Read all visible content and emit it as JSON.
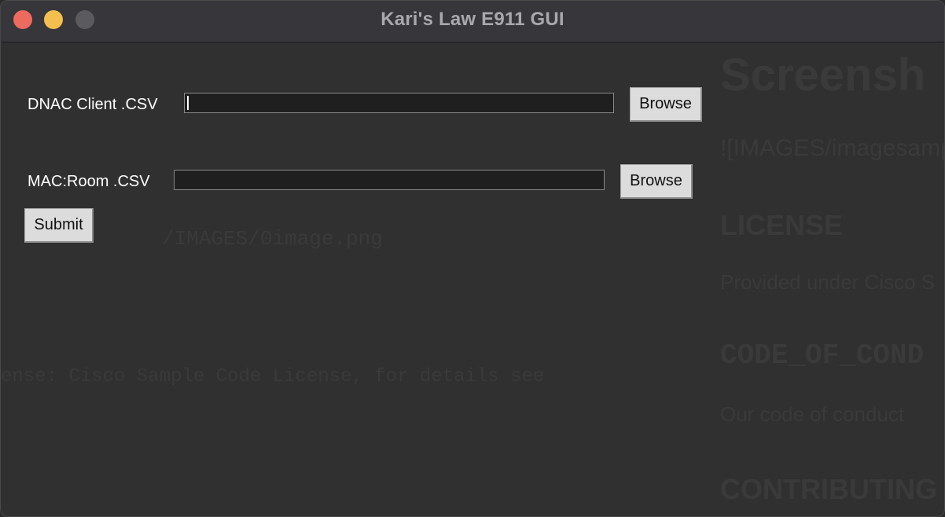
{
  "window": {
    "title": "Kari's Law E911 GUI"
  },
  "form": {
    "dnac_label": "DNAC Client .CSV",
    "dnac_value": "",
    "dnac_browse": "Browse",
    "mac_label": "MAC:Room .CSV",
    "mac_value": "",
    "mac_browse": "Browse",
    "submit": "Submit"
  },
  "background_text": {
    "heading_1": "Screensh",
    "line_2": "![IMAGES/imagesample",
    "heading_3": "LICENSE",
    "line_4": "Provided under Cisco S",
    "heading_5": "CODE_OF_COND",
    "line_6": "Our code of conduct",
    "heading_7": "CONTRIBUTING",
    "line_8": "/IMAGES/0image.png",
    "line_9": "ense: Cisco Sample Code License, for details see"
  }
}
